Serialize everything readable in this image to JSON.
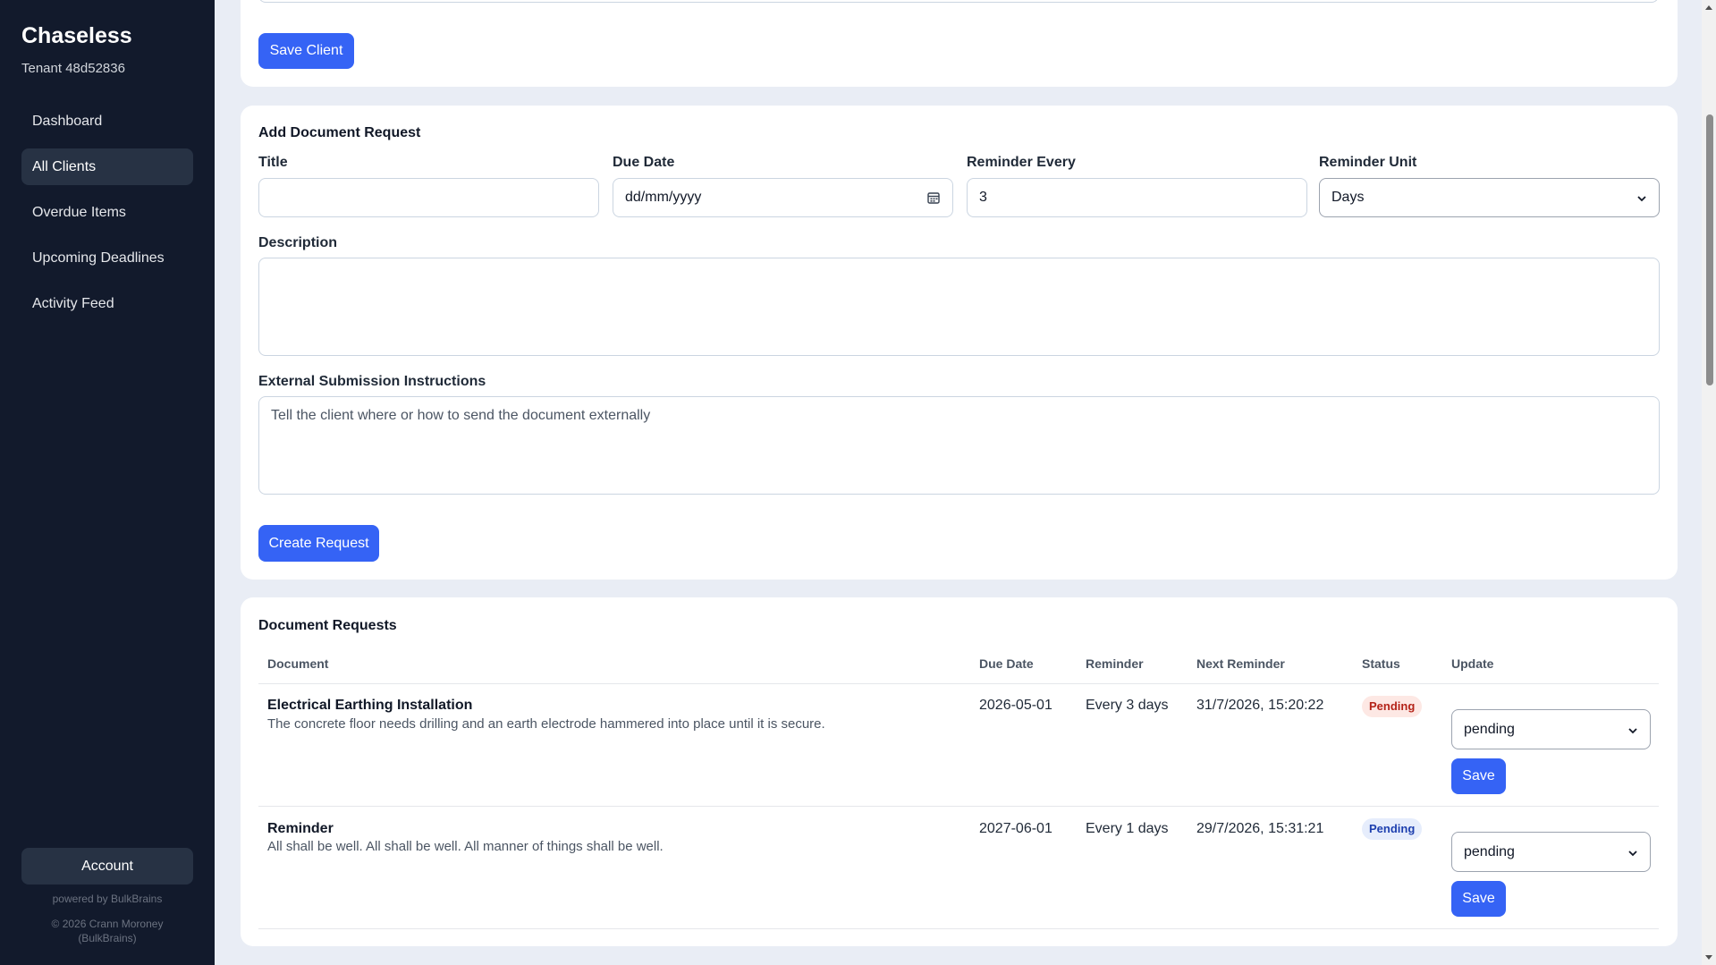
{
  "sidebar": {
    "brand": "Chaseless",
    "tenant": "Tenant 48d52836",
    "items": [
      {
        "label": "Dashboard",
        "active": false
      },
      {
        "label": "All Clients",
        "active": true
      },
      {
        "label": "Overdue Items",
        "active": false
      },
      {
        "label": "Upcoming Deadlines",
        "active": false
      },
      {
        "label": "Activity Feed",
        "active": false
      }
    ],
    "account_label": "Account",
    "powered_by": "powered by BulkBrains",
    "copyright_line1": "© 2026 Crann Moroney",
    "copyright_line2": "(BulkBrains)"
  },
  "client_form": {
    "save_label": "Save Client"
  },
  "request_form": {
    "title": "Add Document Request",
    "title_label": "Title",
    "title_value": "",
    "due_date_label": "Due Date",
    "due_date_placeholder": "dd/mm/yyyy",
    "reminder_every_label": "Reminder Every",
    "reminder_every_value": "3",
    "reminder_unit_label": "Reminder Unit",
    "reminder_unit_value": "Days",
    "description_label": "Description",
    "description_value": "",
    "instructions_label": "External Submission Instructions",
    "instructions_placeholder": "Tell the client where or how to send the document externally",
    "create_label": "Create Request"
  },
  "requests": {
    "title": "Document Requests",
    "columns": {
      "document": "Document",
      "due_date": "Due Date",
      "reminder": "Reminder",
      "next_reminder": "Next Reminder",
      "status": "Status",
      "update": "Update"
    },
    "rows": [
      {
        "title": "Electrical Earthing Installation",
        "description": "The concrete floor needs drilling and an earth electrode hammered into place until it is secure.",
        "due_date": "2026-05-01",
        "reminder": "Every 3 days",
        "next_reminder": "31/7/2026, 15:20:22",
        "status": "Pending",
        "status_color": "#b42318",
        "update_value": "pending",
        "save_label": "Save"
      },
      {
        "title": "Reminder",
        "description": "All shall be well. All shall be well. All manner of things shall be well.",
        "due_date": "2027-06-01",
        "reminder": "Every 1 days",
        "next_reminder": "29/7/2026, 15:31:21",
        "status": "Pending",
        "status_color": "#1e40af",
        "update_value": "pending",
        "save_label": "Save"
      }
    ]
  },
  "colors": {
    "sidebar_bg": "#121a2c",
    "accent": "#3563f5",
    "page_bg": "#e9edf5"
  }
}
